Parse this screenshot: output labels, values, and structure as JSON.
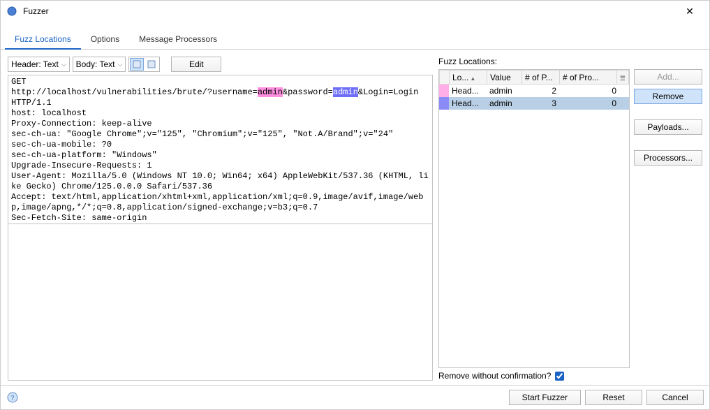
{
  "window": {
    "title": "Fuzzer"
  },
  "tabs": {
    "fuzz_locations": "Fuzz Locations",
    "options": "Options",
    "message_processors": "Message Processors"
  },
  "toolbar": {
    "header_dropdown": "Header: Text",
    "body_dropdown": "Body: Text",
    "edit_label": "Edit"
  },
  "message": {
    "pre1": "GET\nhttp://localhost/vulnerabilities/brute/?username=",
    "hl1": "admin",
    "mid1": "&password=",
    "hl2": "admin",
    "post1": "&Login=Login\nHTTP/1.1\nhost: localhost\nProxy-Connection: keep-alive\nsec-ch-ua: \"Google Chrome\";v=\"125\", \"Chromium\";v=\"125\", \"Not.A/Brand\";v=\"24\"\nsec-ch-ua-mobile: ?0\nsec-ch-ua-platform: \"Windows\"\nUpgrade-Insecure-Requests: 1\nUser-Agent: Mozilla/5.0 (Windows NT 10.0; Win64; x64) AppleWebKit/537.36 (KHTML, like Gecko) Chrome/125.0.0.0 Safari/537.36\nAccept: text/html,application/xhtml+xml,application/xml;q=0.9,image/avif,image/webp,image/apng,*/*;q=0.8,application/signed-exchange;v=b3;q=0.7\nSec-Fetch-Site: same-origin"
  },
  "right": {
    "heading": "Fuzz Locations:",
    "columns": {
      "location": "Lo...",
      "value": "Value",
      "payloads": "# of P...",
      "processors": "# of Pro..."
    },
    "rows": [
      {
        "color": "#ffaee8",
        "location": "Head...",
        "value": "admin",
        "payloads": "2",
        "processors": "0"
      },
      {
        "color": "#8b8bf7",
        "location": "Head...",
        "value": "admin",
        "payloads": "3",
        "processors": "0"
      }
    ],
    "buttons": {
      "add": "Add...",
      "remove": "Remove",
      "payloads": "Payloads...",
      "processors": "Processors..."
    },
    "confirm_label": "Remove without confirmation?"
  },
  "footer": {
    "start": "Start Fuzzer",
    "reset": "Reset",
    "cancel": "Cancel"
  }
}
